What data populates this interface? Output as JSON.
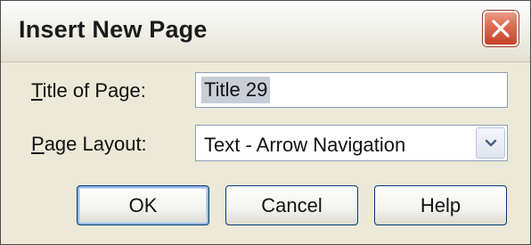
{
  "dialog": {
    "title": "Insert New Page",
    "close_icon": "close-x-icon",
    "accent": "#d9573c"
  },
  "form": {
    "title_label_key": "T",
    "title_label_rest": "itle of Page:",
    "title_value": "Title 29",
    "layout_label_key": "P",
    "layout_label_rest": "age Layout:",
    "layout_value": "Text - Arrow Navigation",
    "dropdown_icon": "chevron-down-icon"
  },
  "buttons": {
    "ok": "OK",
    "cancel": "Cancel",
    "help": "Help"
  }
}
